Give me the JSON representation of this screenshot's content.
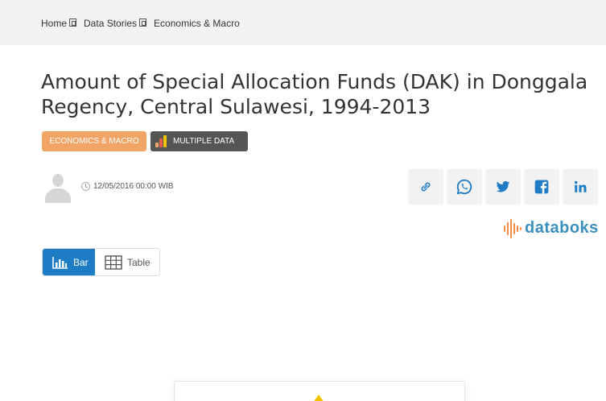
{
  "breadcrumb": {
    "items": [
      "Home",
      "Data Stories",
      "Economics & Macro"
    ]
  },
  "article": {
    "title": "Amount of Special Allocation Funds (DAK) in Donggala Regency, Central Sulawesi, 1994-2013",
    "tags": {
      "category": "ECONOMICS & MACRO",
      "type": "MULTIPLE DATA"
    },
    "published": "12/05/2016 00:00 WIB"
  },
  "share": {
    "icons": [
      "link-icon",
      "whatsapp-icon",
      "twitter-icon",
      "facebook-icon",
      "linkedin-icon"
    ]
  },
  "brand": {
    "logo_text": "databoks"
  },
  "view_toggle": {
    "bar_label": "Bar",
    "table_label": "Table",
    "active": "Bar"
  },
  "colors": {
    "topbar": "#f2f2f2",
    "tag_category": "#f0a465",
    "tag_type": "#555555",
    "active_toggle": "#1e7cc4",
    "logo_text": "#3a8fbf",
    "logo_bars": "#f48c45",
    "share_icons": "#1e7cc4"
  }
}
